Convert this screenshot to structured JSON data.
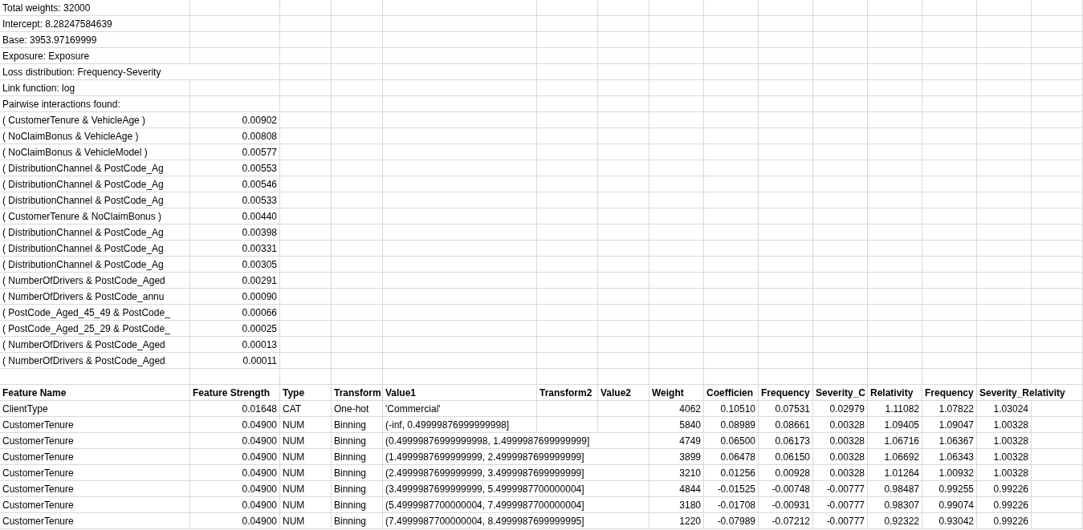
{
  "summary_lines": [
    "Total weights: 32000",
    "Intercept: 8.28247584639",
    "Base: 3953.97169999",
    "Exposure: Exposure",
    "Loss distribution: Frequency-Severity",
    "Link function: log",
    "Pairwise interactions found:"
  ],
  "interactions": [
    {
      "pair": "( CustomerTenure & VehicleAge )",
      "strength": "0.00902"
    },
    {
      "pair": "( NoClaimBonus & VehicleAge )",
      "strength": "0.00808"
    },
    {
      "pair": "( NoClaimBonus & VehicleModel )",
      "strength": "0.00577"
    },
    {
      "pair": "( DistributionChannel & PostCode_Ag",
      "strength": "0.00553"
    },
    {
      "pair": "( DistributionChannel & PostCode_Ag",
      "strength": "0.00546"
    },
    {
      "pair": "( DistributionChannel & PostCode_Ag",
      "strength": "0.00533"
    },
    {
      "pair": "( CustomerTenure & NoClaimBonus )",
      "strength": "0.00440"
    },
    {
      "pair": "( DistributionChannel & PostCode_Ag",
      "strength": "0.00398"
    },
    {
      "pair": "( DistributionChannel & PostCode_Ag",
      "strength": "0.00331"
    },
    {
      "pair": "( DistributionChannel & PostCode_Ag",
      "strength": "0.00305"
    },
    {
      "pair": "( NumberOfDrivers & PostCode_Aged",
      "strength": "0.00291"
    },
    {
      "pair": "( NumberOfDrivers & PostCode_annu",
      "strength": "0.00090"
    },
    {
      "pair": "( PostCode_Aged_45_49 & PostCode_",
      "strength": "0.00066"
    },
    {
      "pair": "( PostCode_Aged_25_29 & PostCode_",
      "strength": "0.00025"
    },
    {
      "pair": "( NumberOfDrivers & PostCode_Aged",
      "strength": "0.00013"
    },
    {
      "pair": "( NumberOfDrivers & PostCode_Aged",
      "strength": "0.00011"
    }
  ],
  "table": {
    "columns": [
      {
        "label": "Feature Name",
        "kind": "text"
      },
      {
        "label": "Feature Strength",
        "kind": "number"
      },
      {
        "label": "Type",
        "kind": "text"
      },
      {
        "label": "Transform",
        "kind": "text"
      },
      {
        "label": "Value1",
        "kind": "text"
      },
      {
        "label": "Transform2",
        "kind": "text"
      },
      {
        "label": "Value2",
        "kind": "text"
      },
      {
        "label": "Weight",
        "kind": "number"
      },
      {
        "label": "Coefficien",
        "kind": "number"
      },
      {
        "label": "Frequency",
        "kind": "number"
      },
      {
        "label": "Severity_C",
        "kind": "number"
      },
      {
        "label": "Relativity",
        "kind": "number"
      },
      {
        "label": "Frequency",
        "kind": "number"
      },
      {
        "label": "Severity_Relativity",
        "kind": "number"
      }
    ],
    "rows": [
      [
        "ClientType",
        "0.01648",
        "CAT",
        "One-hot",
        "'Commercial'",
        "",
        "",
        "4062",
        "0.10510",
        "0.07531",
        "0.02979",
        "1.11082",
        "1.07822",
        "1.03024"
      ],
      [
        "CustomerTenure",
        "0.04900",
        "NUM",
        "Binning",
        "(-inf, 0.49999876999999998]",
        "",
        "",
        "5840",
        "0.08989",
        "0.08661",
        "0.00328",
        "1.09405",
        "1.09047",
        "1.00328"
      ],
      [
        "CustomerTenure",
        "0.04900",
        "NUM",
        "Binning",
        "(0.49999876999999998, 1.4999987699999999]",
        "",
        "",
        "4749",
        "0.06500",
        "0.06173",
        "0.00328",
        "1.06716",
        "1.06367",
        "1.00328"
      ],
      [
        "CustomerTenure",
        "0.04900",
        "NUM",
        "Binning",
        "(1.4999987699999999, 2.4999987699999999]",
        "",
        "",
        "3899",
        "0.06478",
        "0.06150",
        "0.00328",
        "1.06692",
        "1.06343",
        "1.00328"
      ],
      [
        "CustomerTenure",
        "0.04900",
        "NUM",
        "Binning",
        "(2.4999987699999999, 3.4999987699999999]",
        "",
        "",
        "3210",
        "0.01256",
        "0.00928",
        "0.00328",
        "1.01264",
        "1.00932",
        "1.00328"
      ],
      [
        "CustomerTenure",
        "0.04900",
        "NUM",
        "Binning",
        "(3.4999987699999999, 5.4999987700000004]",
        "",
        "",
        "4844",
        "-0.01525",
        "-0.00748",
        "-0.00777",
        "0.98487",
        "0.99255",
        "0.99226"
      ],
      [
        "CustomerTenure",
        "0.04900",
        "NUM",
        "Binning",
        "(5.4999987700000004, 7.4999987700000004]",
        "",
        "",
        "3180",
        "-0.01708",
        "-0.00931",
        "-0.00777",
        "0.98307",
        "0.99074",
        "0.99226"
      ],
      [
        "CustomerTenure",
        "0.04900",
        "NUM",
        "Binning",
        "(7.4999987700000004, 8.4999987699999995]",
        "",
        "",
        "1220",
        "-0.07989",
        "-0.07212",
        "-0.00777",
        "0.92322",
        "0.93042",
        "0.99226"
      ]
    ]
  }
}
